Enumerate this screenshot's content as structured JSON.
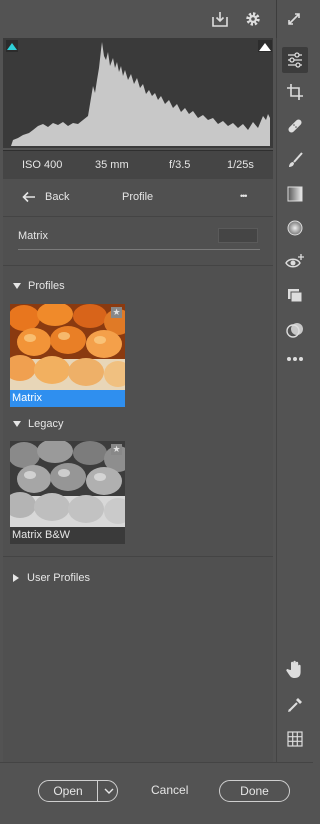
{
  "exif": {
    "iso": "ISO 400",
    "focal": "35 mm",
    "aperture": "f/3.5",
    "shutter": "1/25s"
  },
  "nav": {
    "back_label": "Back",
    "title": "Profile",
    "more_label": "•••"
  },
  "profile_field": {
    "label": "Matrix",
    "amount": ""
  },
  "groups": {
    "profiles": {
      "label": "Profiles",
      "item": "Matrix"
    },
    "legacy": {
      "label": "Legacy",
      "item": "Matrix B&W"
    },
    "user": {
      "label": "User Profiles"
    }
  },
  "buttons": {
    "open": "Open",
    "cancel": "Cancel",
    "done": "Done"
  },
  "colors": {
    "selected": "#2f8fef",
    "panel": "#505050",
    "histogram": "#c8c8c8"
  },
  "icons": {
    "top": [
      "save-icon",
      "gear-icon",
      "expand-icon"
    ],
    "tools": [
      "edit-sliders-icon",
      "crop-icon",
      "healing-icon",
      "brush-icon",
      "linear-gradient-icon",
      "radial-filter-icon",
      "red-eye-icon",
      "snapshots-icon",
      "presets-icon",
      "more-icon",
      "hand-icon",
      "color-sampler-icon",
      "grid-icon"
    ]
  }
}
